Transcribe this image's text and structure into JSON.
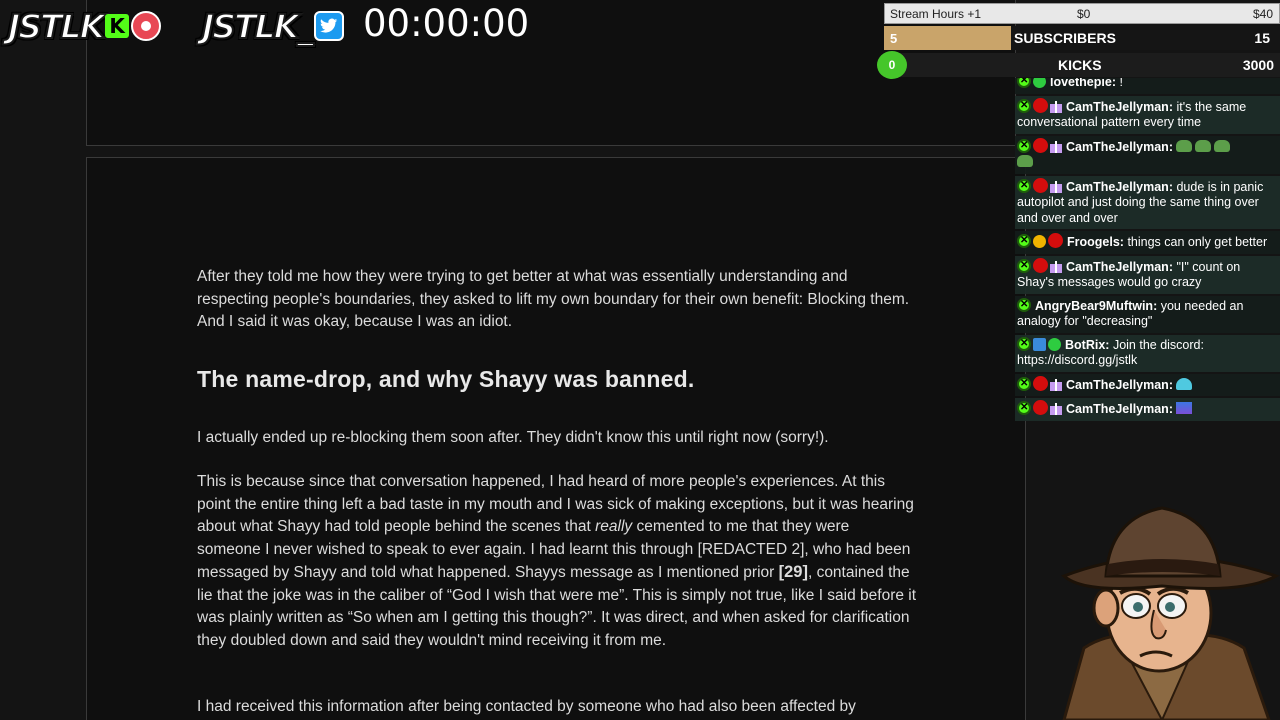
{
  "overlay": {
    "logo_kick": "JSTLK",
    "logo_kick_badge": "K",
    "logo_twitter": "JSTLK_",
    "timer": "00:00:00"
  },
  "stats": {
    "hours_label": "Stream Hours +1",
    "hours_min": "$0",
    "hours_max": "$40",
    "subs_count": "5",
    "subs_label": "SUBSCRIBERS",
    "subs_goal": "15",
    "kicks_count": "0",
    "kicks_label": "KICKS",
    "kicks_goal": "3000"
  },
  "chat": [
    {
      "user": "lovethepie:",
      "text": "!"
    },
    {
      "user": "CamTheJellyman:",
      "text": "it's the same conversational pattern every time"
    },
    {
      "user": "CamTheJellyman:",
      "text": ""
    },
    {
      "user": "CamTheJellyman:",
      "text": "dude is in panic autopilot and just doing the same thing over and over and over"
    },
    {
      "user": "Froogels:",
      "text": "things can only get better"
    },
    {
      "user": "CamTheJellyman:",
      "text": "\"I\" count on Shay's messages would go crazy"
    },
    {
      "user": "AngryBear9Muftwin:",
      "text": "you needed an analogy for \"decreasing\""
    },
    {
      "user": "BotRix:",
      "text": "Join the discord: https://discord.gg/jstlk"
    },
    {
      "user": "CamTheJellyman:",
      "text": ""
    },
    {
      "user": "CamTheJellyman:",
      "text": ""
    }
  ],
  "document": {
    "para1": "After they told me how they were trying to get better at what was essentially understanding and respecting people's boundaries, they asked to lift my own boundary for their own benefit: Blocking them. And I said it was okay, because I was an idiot.",
    "heading": "The name-drop, and why Shayy was banned.",
    "para2": "I actually ended up re-blocking them soon after. They didn't know this until right now (sorry!).",
    "para3_a": "This is because since that conversation happened, I had heard of more people's experiences. At this point the entire thing left a bad taste in my mouth and I was sick of making exceptions, but it was hearing about what Shayy had told people behind the scenes that ",
    "para3_em": "really",
    "para3_b": " cemented to me that they were someone I never wished to speak to ever again. I had learnt this through [REDACTED 2], who had been messaged by Shayy and told what happened. Shayys message as I mentioned prior ",
    "para3_cite": "[29]",
    "para3_c": ", contained the lie that the joke was in the caliber of “God I wish that were me”. This is simply not true, like I said before it was plainly written as “So when am I getting this though?”. It was direct, and when asked for clarification they doubled down and said they wouldn't mind receiving it from me.",
    "para4": "I had received this information after being contacted by someone who had also been affected by"
  }
}
